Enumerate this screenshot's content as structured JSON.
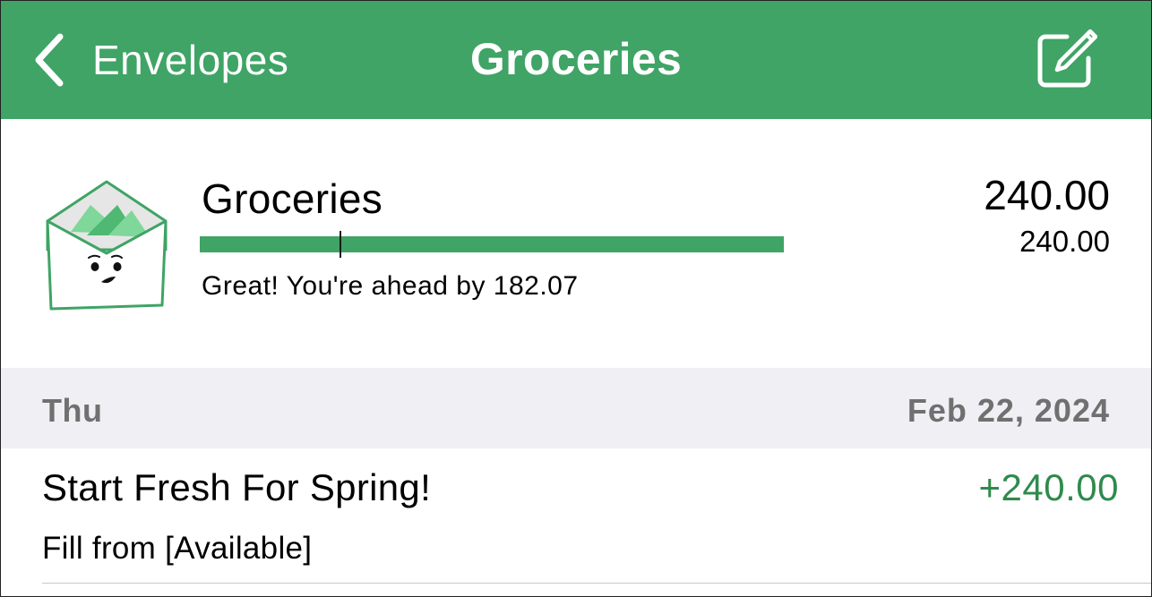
{
  "nav": {
    "back_label": "Envelopes",
    "title": "Groceries",
    "back_icon": "chevron-left-icon",
    "edit_icon": "compose-icon"
  },
  "envelope": {
    "name": "Groceries",
    "icon": "envelope-mascot-icon",
    "amount_primary": "240.00",
    "amount_secondary": "240.00",
    "status_text": "Great! You're ahead by 182.07",
    "progress_fraction": 1.0,
    "time_marker_fraction": 0.24
  },
  "section": {
    "day": "Thu",
    "date": "Feb 22, 2024"
  },
  "transactions": [
    {
      "title": "Start Fresh For Spring!",
      "amount": "+240.00",
      "subtitle": "Fill from [Available]"
    }
  ],
  "colors": {
    "brand_green": "#3fa465",
    "positive_amount": "#2f8a4c",
    "section_bg": "#efeff4",
    "section_text": "#707070"
  }
}
